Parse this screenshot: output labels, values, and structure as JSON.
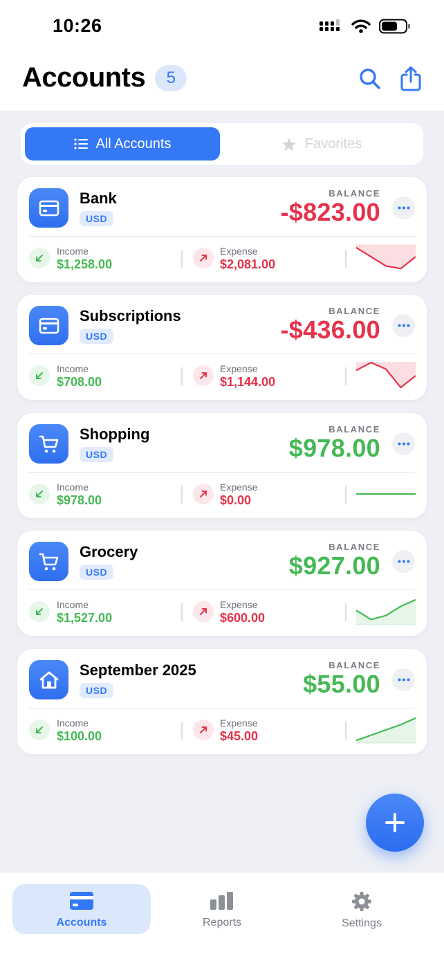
{
  "status_bar": {
    "time": "10:26"
  },
  "header": {
    "title": "Accounts",
    "count": "5"
  },
  "segments": {
    "all": "All Accounts",
    "favorites": "Favorites"
  },
  "labels": {
    "balance": "BALANCE",
    "income": "Income",
    "expense": "Expense"
  },
  "colors": {
    "accent": "#3478f6",
    "positive": "#45b955",
    "negative": "#e5334b"
  },
  "accounts": [
    {
      "name": "Bank",
      "currency": "USD",
      "icon": "card-icon",
      "balance": "-$823.00",
      "income": "$1,258.00",
      "expense": "$2,081.00",
      "trend": "negative",
      "spark": [
        0.9,
        0.55,
        0.2,
        0.1,
        0.55
      ]
    },
    {
      "name": "Subscriptions",
      "currency": "USD",
      "icon": "card-icon",
      "balance": "-$436.00",
      "income": "$708.00",
      "expense": "$1,144.00",
      "trend": "negative",
      "spark": [
        0.7,
        1.0,
        0.75,
        0.05,
        0.5
      ]
    },
    {
      "name": "Shopping",
      "currency": "USD",
      "icon": "cart-icon",
      "balance": "$978.00",
      "income": "$978.00",
      "expense": "$0.00",
      "trend": "positive",
      "spark": [
        0.5,
        0.5,
        0.5,
        0.5,
        0.5
      ]
    },
    {
      "name": "Grocery",
      "currency": "USD",
      "icon": "cart-icon",
      "balance": "$927.00",
      "income": "$1,527.00",
      "expense": "$600.00",
      "trend": "positive",
      "spark": [
        0.55,
        0.2,
        0.35,
        0.7,
        0.95
      ]
    },
    {
      "name": "September 2025",
      "currency": "USD",
      "icon": "home-icon",
      "balance": "$55.00",
      "income": "$100.00",
      "expense": "$45.00",
      "trend": "positive",
      "spark": [
        0.1,
        0.3,
        0.5,
        0.7,
        0.95
      ]
    }
  ],
  "tabs": [
    {
      "label": "Accounts",
      "icon": "card-icon",
      "active": true
    },
    {
      "label": "Reports",
      "icon": "bar-chart-icon",
      "active": false
    },
    {
      "label": "Settings",
      "icon": "gear-icon",
      "active": false
    }
  ]
}
